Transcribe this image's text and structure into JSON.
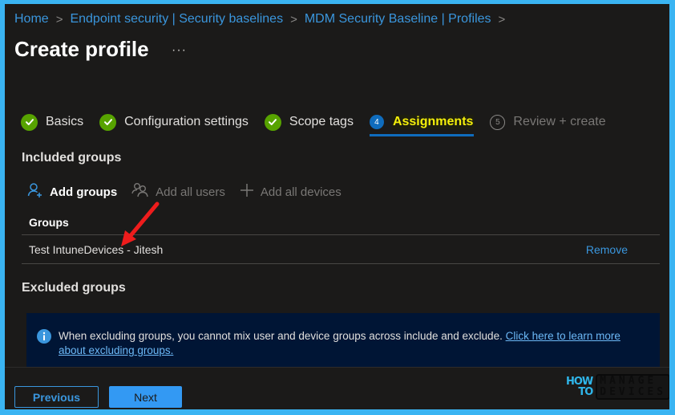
{
  "breadcrumb": [
    {
      "label": "Home"
    },
    {
      "label": "Endpoint security | Security baselines"
    },
    {
      "label": "MDM Security Baseline | Profiles"
    }
  ],
  "breadcrumb_separator": ">",
  "header": {
    "title": "Create profile",
    "more_label": "···"
  },
  "wizard": {
    "steps": [
      {
        "label": "Basics",
        "status": "completed"
      },
      {
        "label": "Configuration settings",
        "status": "completed"
      },
      {
        "label": "Scope tags",
        "status": "completed"
      },
      {
        "label": "Assignments",
        "status": "current",
        "number": "4"
      },
      {
        "label": "Review + create",
        "status": "upcoming",
        "number": "5"
      }
    ]
  },
  "included": {
    "heading": "Included groups",
    "toolbar": {
      "add_groups": "Add groups",
      "add_all_users": "Add all users",
      "add_all_devices": "Add all devices"
    },
    "table": {
      "column_header": "Groups",
      "rows": [
        {
          "name": "Test IntuneDevices - Jitesh",
          "action": "Remove"
        }
      ]
    }
  },
  "excluded": {
    "heading": "Excluded groups",
    "info": {
      "message": "When excluding groups, you cannot mix user and device groups across include and exclude. ",
      "link_line1": "Click here to learn more",
      "link_line2": "about excluding groups."
    }
  },
  "footer": {
    "previous_label": "Previous",
    "next_label": "Next"
  },
  "watermark": {
    "how_to_line1": "HOW",
    "how_to_line2": "TO",
    "brand_line1": "MANAGE",
    "brand_line2": "DEVICES"
  },
  "colors": {
    "accent": "#0f6cbd",
    "link": "#3a96dd",
    "success": "#57a300",
    "active_step_text": "#f5f00a",
    "info_bar_bg": "#001535",
    "frame_border": "#3ab4f2"
  }
}
